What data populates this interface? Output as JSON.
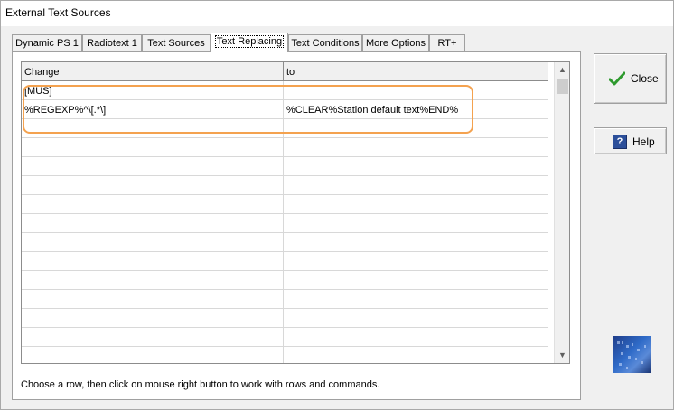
{
  "window": {
    "title": "External Text Sources"
  },
  "tabs": [
    {
      "label": "Dynamic PS 1"
    },
    {
      "label": "Radiotext 1"
    },
    {
      "label": "Text Sources"
    },
    {
      "label": "Text Replacing"
    },
    {
      "label": "Text Conditions"
    },
    {
      "label": "More Options"
    },
    {
      "label": "RT+"
    }
  ],
  "active_tab": "Text Replacing",
  "grid": {
    "columns": [
      "Change",
      "to"
    ],
    "rows": [
      [
        "[MUS]",
        ""
      ],
      [
        "%REGEXP%^\\[.*\\]",
        "%CLEAR%Station default text%END%"
      ],
      [
        "",
        ""
      ],
      [
        "",
        ""
      ],
      [
        "",
        ""
      ],
      [
        "",
        ""
      ],
      [
        "",
        ""
      ],
      [
        "",
        ""
      ],
      [
        "",
        ""
      ],
      [
        "",
        ""
      ],
      [
        "",
        ""
      ],
      [
        "",
        ""
      ],
      [
        "",
        ""
      ],
      [
        "",
        ""
      ],
      [
        "",
        ""
      ]
    ]
  },
  "hint": "Choose a row, then click on mouse right button to work with rows and commands.",
  "buttons": {
    "close_label": "Close",
    "help_label": "Help"
  },
  "colors": {
    "highlight": "#f4a24f",
    "check": "#2e9a2e",
    "help_icon": "#2c4f9a"
  },
  "icons": {
    "close": "check-icon",
    "help": "help-icon",
    "logo": "app-logo-icon"
  }
}
